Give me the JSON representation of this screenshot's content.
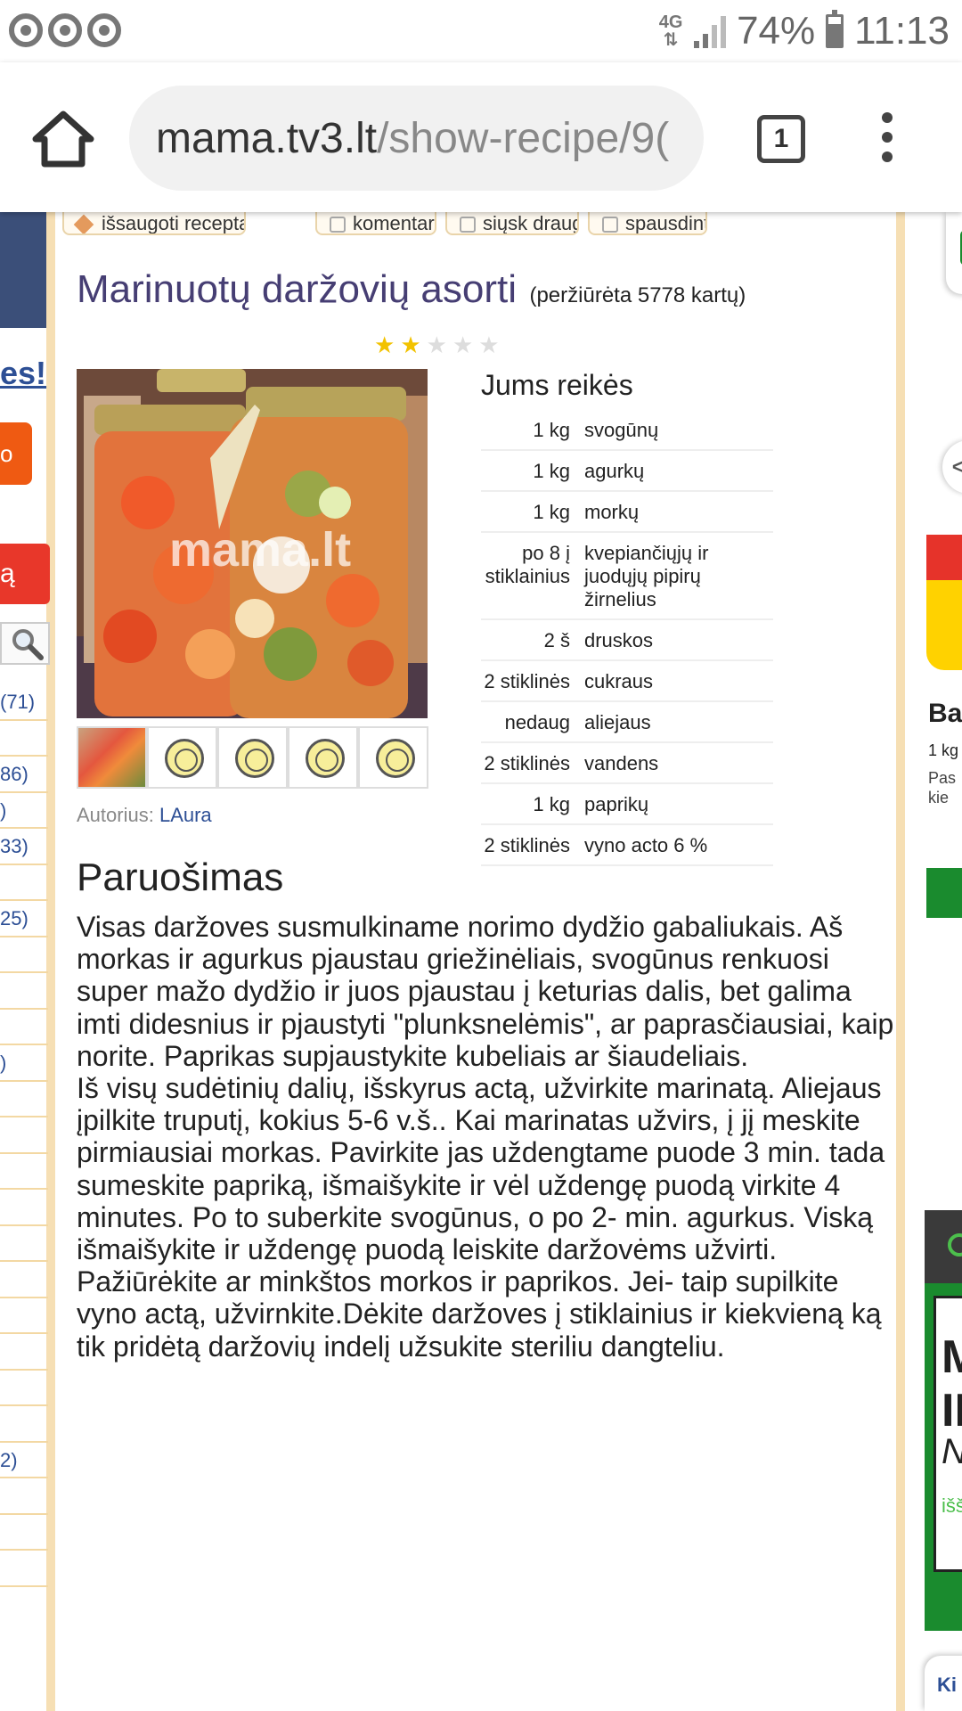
{
  "status_bar": {
    "network": "4G",
    "battery": "74%",
    "time": "11:13"
  },
  "browser": {
    "url_domain": "mama.tv3.lt",
    "url_path": "/show-recipe/9(",
    "tab_count": "1"
  },
  "top_buttons": {
    "save": "išsaugoti receptą",
    "comments": "komentarai",
    "send": "siųsk draugui",
    "print": "spausdinti"
  },
  "recipe": {
    "title": "Marinuotų daržovių asorti",
    "views": "(peržiūrėta 5778 kartų)",
    "rating": 2,
    "rating_max": 5,
    "author_label": "Autorius:",
    "author": "LAura",
    "watermark": "mama.lt"
  },
  "ingredients": {
    "title": "Jums reikės",
    "items": [
      {
        "qty": "1 kg",
        "name": "svogūnų"
      },
      {
        "qty": "1 kg",
        "name": "agurkų"
      },
      {
        "qty": "1 kg",
        "name": "morkų"
      },
      {
        "qty": "po 8 į stiklainius",
        "name": "kvepiančiųjų ir juodųjų pipirų žirnelius"
      },
      {
        "qty": "2 š",
        "name": "druskos"
      },
      {
        "qty": "2 stiklinės",
        "name": "cukraus"
      },
      {
        "qty": "nedaug",
        "name": "aliejaus"
      },
      {
        "qty": "2 stiklinės",
        "name": "vandens"
      },
      {
        "qty": "1 kg",
        "name": "paprikų"
      },
      {
        "qty": "2 stiklinės",
        "name": "vyno acto 6 %"
      }
    ]
  },
  "preparation": {
    "title": "Paruošimas",
    "text": "Visas daržoves susmulkiname norimo dydžio gabaliukais. Aš morkas ir agurkus pjaustau griežinėliais, svogūnus renkuosi super mažo dydžio ir juos pjaustau į keturias dalis, bet galima imti didesnius ir pjaustyti \"plunksnelėmis\", ar paprasčiausiai, kaip norite. Paprikas supjaustykite kubeliais ar šiaudeliais.\nIš visų sudėtinių dalių, išskyrus actą, užvirkite marinatą. Aliejaus įpilkite truputį, kokius 5-6 v.š.. Kai marinatas užvirs, į jį meskite pirmiausiai morkas. Pavirkite jas uždengtame puode 3 min. tada sumeskite papriką, išmaišykite ir vėl uždengę puodą virkite 4 minutes. Po to suberkite svogūnus, o po 2- min. agurkus. Viską išmaišykite ir uždengę puodą leiskite daržovėms užvirti. Pažiūrėkite ar minkštos morkos ir paprikos. Jei- taip supilkite vyno actą, užvirnkite.Dėkite daržoves į stiklainius ir kiekvieną ką tik pridėtą daržovių indelį užsukite steriliu dangteliu."
  },
  "left_sidebar": {
    "es_text": "es!",
    "orange_btn": "o",
    "red_btn": "ą",
    "items": [
      "(71)",
      "",
      "86)",
      ")",
      "33)",
      "",
      "25)",
      "",
      "",
      "",
      ")",
      "",
      "",
      "",
      "",
      "",
      "",
      "",
      "",
      "",
      "",
      "2)",
      "",
      "",
      ""
    ]
  },
  "right_sidebar": {
    "arrow": "<",
    "heading": "Ba",
    "sub1": "1 kg",
    "sub2": "Pas kie",
    "ad_m": "M",
    "ad_ii": "II",
    "ad_n": "N",
    "ad_iss": "išš",
    "bottom": "Ki"
  },
  "colors": {
    "title": "#463e73",
    "link": "#2d4f95",
    "border": "#f6dfb4",
    "star_on": "#f2c200",
    "star_off": "#dddddd"
  }
}
